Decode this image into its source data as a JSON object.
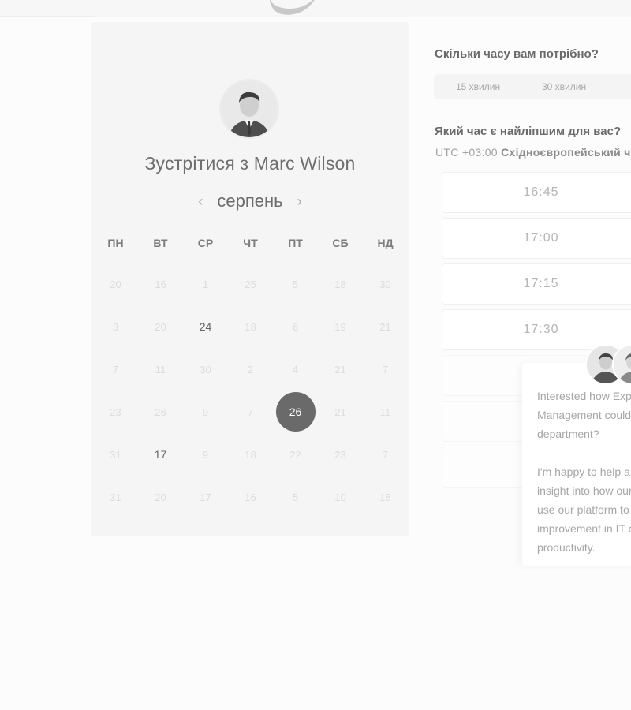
{
  "calendar": {
    "title": "Зустрітися з Marc Wilson",
    "month": "серпень",
    "weekdays": [
      "ПН",
      "ВТ",
      "СР",
      "ЧТ",
      "ПТ",
      "СБ",
      "НД"
    ],
    "days": [
      {
        "label": "20",
        "state": "disabled"
      },
      {
        "label": "16",
        "state": "disabled"
      },
      {
        "label": "1",
        "state": "disabled"
      },
      {
        "label": "25",
        "state": "disabled"
      },
      {
        "label": "5",
        "state": "disabled"
      },
      {
        "label": "18",
        "state": "disabled"
      },
      {
        "label": "30",
        "state": "disabled"
      },
      {
        "label": "3",
        "state": "disabled"
      },
      {
        "label": "20",
        "state": "disabled"
      },
      {
        "label": "24",
        "state": "available"
      },
      {
        "label": "18",
        "state": "disabled"
      },
      {
        "label": "6",
        "state": "disabled"
      },
      {
        "label": "19",
        "state": "disabled"
      },
      {
        "label": "21",
        "state": "disabled"
      },
      {
        "label": "7",
        "state": "disabled"
      },
      {
        "label": "11",
        "state": "disabled"
      },
      {
        "label": "30",
        "state": "disabled"
      },
      {
        "label": "2",
        "state": "disabled"
      },
      {
        "label": "4",
        "state": "disabled"
      },
      {
        "label": "21",
        "state": "disabled"
      },
      {
        "label": "7",
        "state": "disabled"
      },
      {
        "label": "23",
        "state": "disabled"
      },
      {
        "label": "26",
        "state": "disabled"
      },
      {
        "label": "9",
        "state": "disabled"
      },
      {
        "label": "7",
        "state": "disabled"
      },
      {
        "label": "26",
        "state": "selected"
      },
      {
        "label": "21",
        "state": "disabled"
      },
      {
        "label": "11",
        "state": "disabled"
      },
      {
        "label": "31",
        "state": "disabled"
      },
      {
        "label": "17",
        "state": "available"
      },
      {
        "label": "9",
        "state": "disabled"
      },
      {
        "label": "18",
        "state": "disabled"
      },
      {
        "label": "22",
        "state": "disabled"
      },
      {
        "label": "23",
        "state": "disabled"
      },
      {
        "label": "7",
        "state": "disabled"
      },
      {
        "label": "31",
        "state": "disabled"
      },
      {
        "label": "20",
        "state": "disabled"
      },
      {
        "label": "17",
        "state": "disabled"
      },
      {
        "label": "16",
        "state": "disabled"
      },
      {
        "label": "5",
        "state": "disabled"
      },
      {
        "label": "10",
        "state": "disabled"
      },
      {
        "label": "18",
        "state": "disabled"
      }
    ]
  },
  "booking": {
    "duration_question": "Скільки часу вам потрібно?",
    "durations": [
      "15 хвилин",
      "30 хвилин"
    ],
    "time_question": "Який час є найліпшим для вас?",
    "tz_offset": "UTC +03:00",
    "tz_name": "Східноєвропейський час",
    "slots": [
      "16:45",
      "17:00",
      "17:15",
      "17:30"
    ]
  },
  "chat": {
    "message": "Interested how Exp\nManagement could\ndepartment?\n\nI'm happy to help a\ninsight into how our\nuse our platform to\nimprovement in IT c\nproductivity."
  },
  "icons": {
    "prev_month": "chevron-left-icon",
    "next_month": "chevron-right-icon"
  },
  "colors": {
    "selected_day": "#6a6a6a",
    "panel_bg": "#f5f5f5"
  }
}
